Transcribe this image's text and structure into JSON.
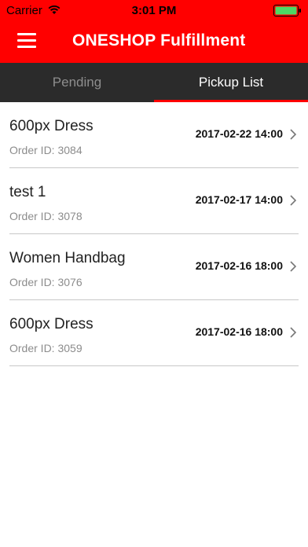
{
  "status_bar": {
    "carrier": "Carrier",
    "time": "3:01 PM"
  },
  "header": {
    "title": "ONESHOP Fulfillment",
    "background_color": "#ff0000"
  },
  "tabs": [
    {
      "label": "Pending",
      "active": false
    },
    {
      "label": "Pickup List",
      "active": true
    }
  ],
  "orders": [
    {
      "name": "600px Dress",
      "order_id": "Order ID: 3084",
      "datetime": "2017-02-22 14:00"
    },
    {
      "name": "test 1",
      "order_id": "Order ID: 3078",
      "datetime": "2017-02-17 14:00"
    },
    {
      "name": "Women Handbag",
      "order_id": "Order ID: 3076",
      "datetime": "2017-02-16 18:00"
    },
    {
      "name": "600px Dress",
      "order_id": "Order ID: 3059",
      "datetime": "2017-02-16 18:00"
    }
  ],
  "icons": {
    "menu": "hamburger-menu-icon",
    "row_arrow": "chevron-right-icon"
  }
}
